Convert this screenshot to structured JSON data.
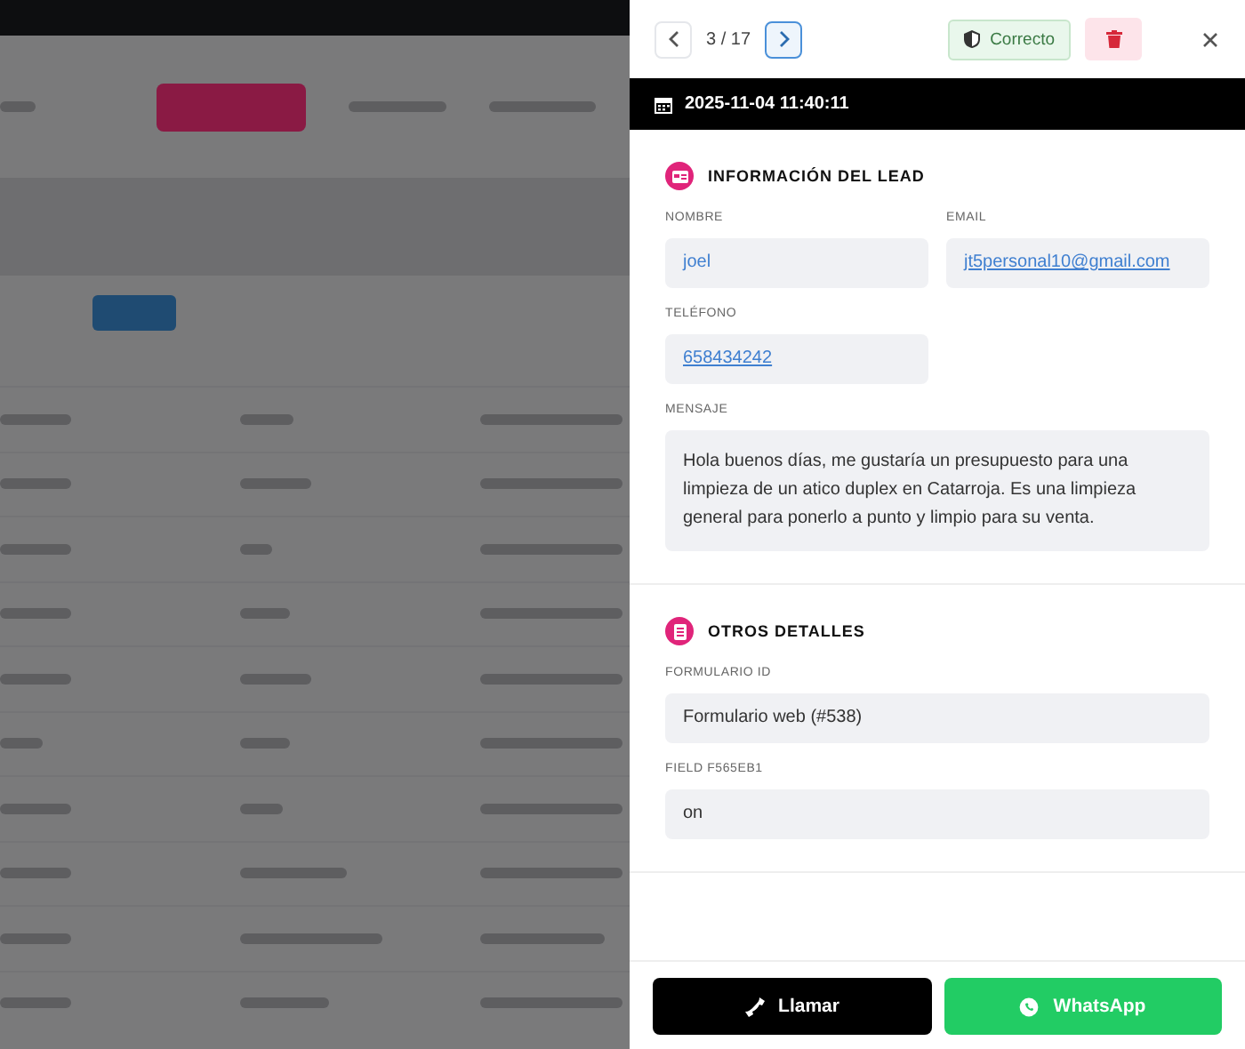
{
  "panel": {
    "pager": "3 / 17",
    "status_button": "Correcto",
    "date": "2025-11-04 11:40:11",
    "sections": [
      {
        "title": "INFORMACIÓN DEL LEAD",
        "kind": "lead",
        "fields": [
          {
            "label": "NOMBRE",
            "value": "joel",
            "kind": "half"
          },
          {
            "label": "EMAIL",
            "value": "jt5personal10@gmail.com",
            "kind": "half-link"
          },
          {
            "label": "TELÉFONO",
            "value": "658434242",
            "kind": "half-link"
          },
          {
            "label": "MENSAJE",
            "value": "Hola buenos días, me gustaría un presupuesto para una limpieza de un atico duplex en Catarroja. Es una limpieza general para ponerlo a punto y limpio para su venta.",
            "kind": "message"
          }
        ]
      },
      {
        "title": "OTROS DETALLES",
        "kind": "other",
        "fields": [
          {
            "label": "FORMULARIO ID",
            "value": "Formulario web (#538)",
            "kind": "full"
          },
          {
            "label": "FIELD F565EB1",
            "value": "on",
            "kind": "full"
          }
        ]
      }
    ],
    "actions": [
      {
        "label": "Llamar",
        "kind": "call"
      },
      {
        "label": "WhatsApp",
        "kind": "whatsapp"
      }
    ]
  }
}
